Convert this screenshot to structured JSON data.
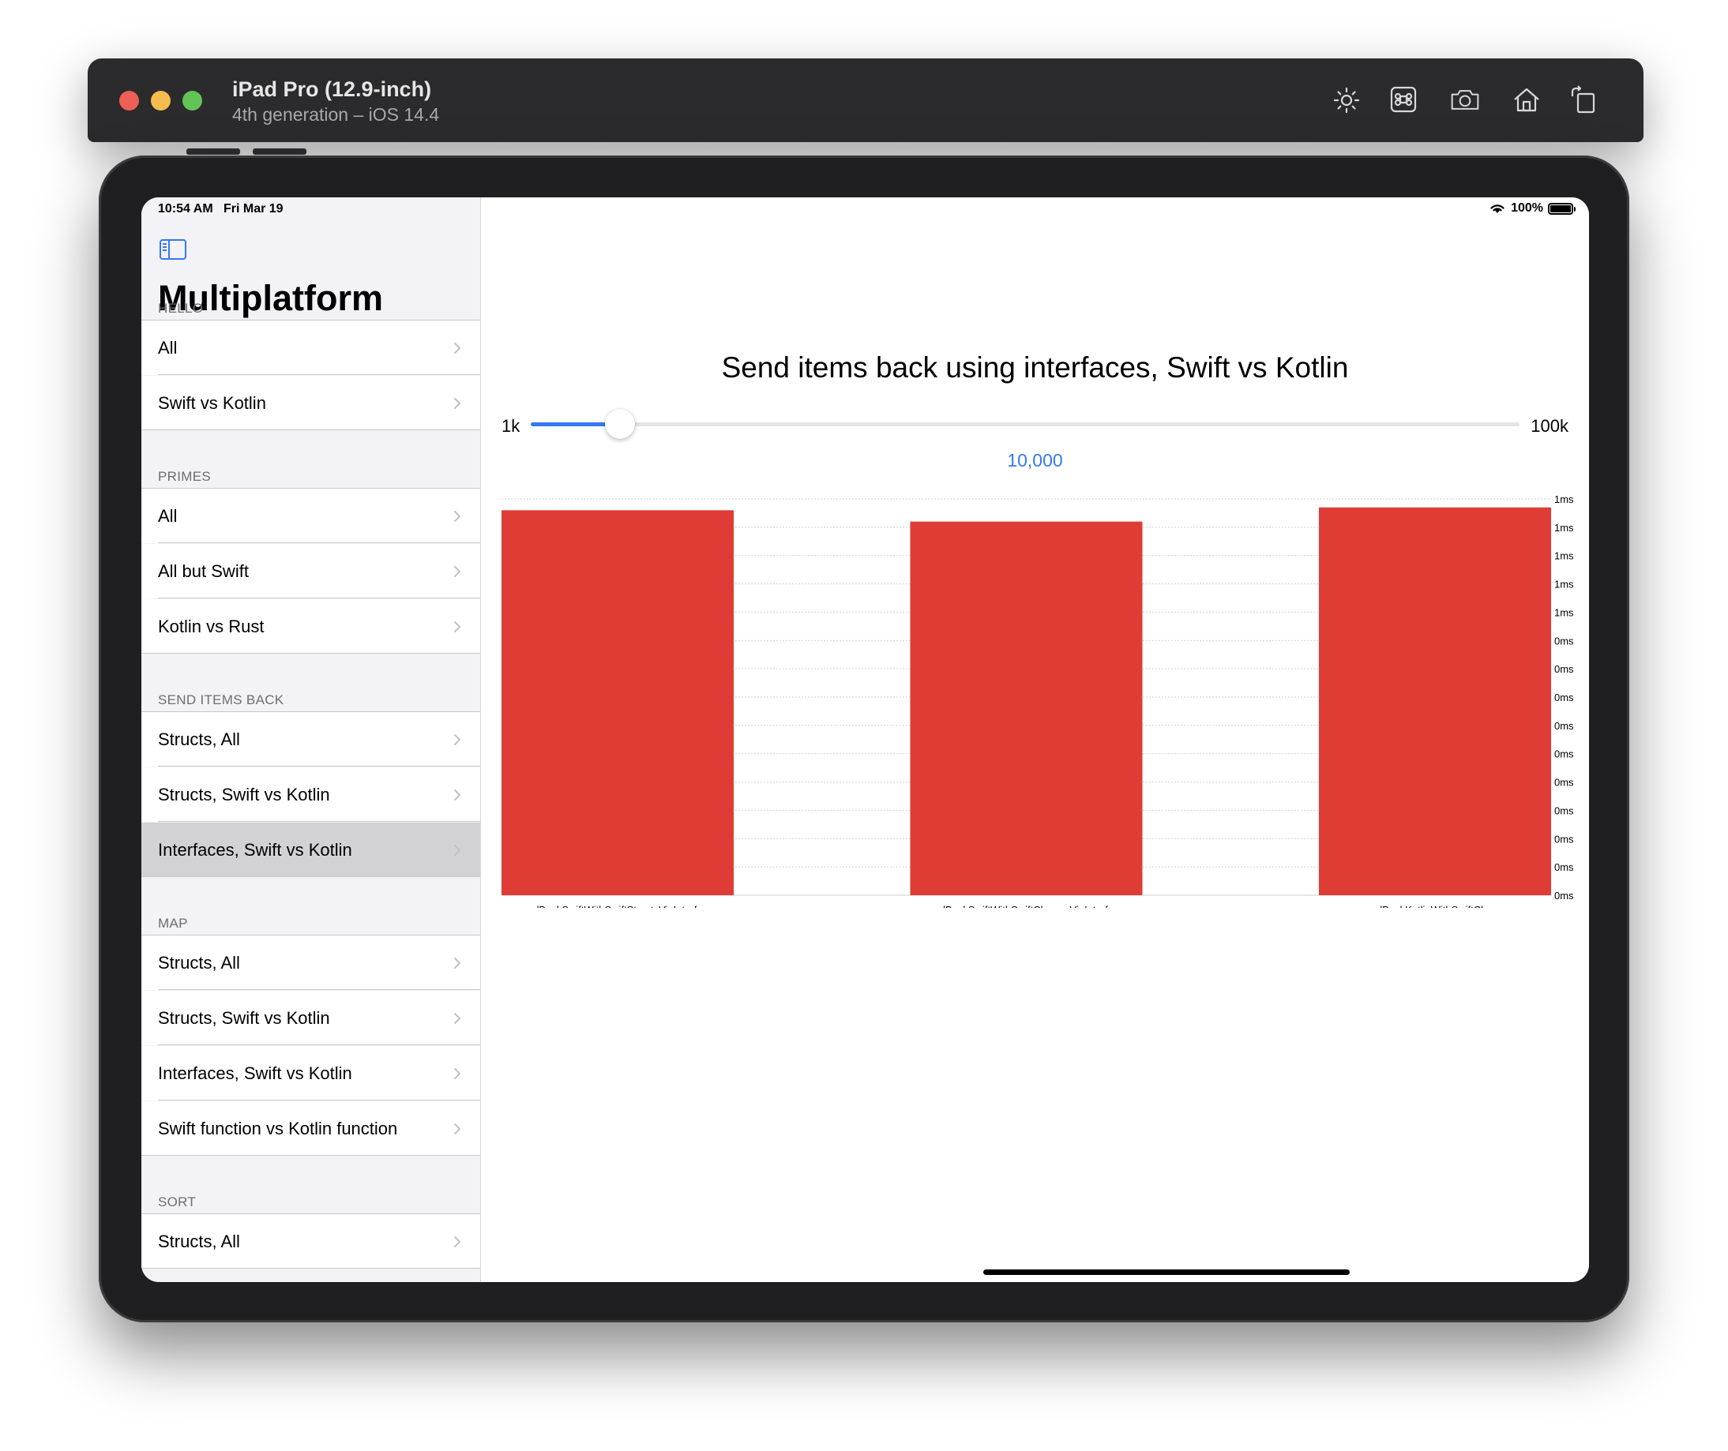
{
  "simulator": {
    "title": "iPad Pro (12.9-inch)",
    "subtitle": "4th generation – iOS 14.4",
    "tools": [
      "brightness-icon",
      "command-icon",
      "screenshot-icon",
      "home-icon",
      "rotate-icon"
    ]
  },
  "status_bar": {
    "time": "10:54 AM   Fri Mar 19",
    "battery": "100%"
  },
  "sidebar": {
    "title": "Multiplatform",
    "sections": [
      {
        "header": "HELLO",
        "items": [
          "All",
          "Swift vs Kotlin"
        ]
      },
      {
        "header": "PRIMES",
        "items": [
          "All",
          "All but Swift",
          "Kotlin vs Rust"
        ]
      },
      {
        "header": "SEND ITEMS BACK",
        "items": [
          "Structs, All",
          "Structs, Swift vs Kotlin",
          "Interfaces, Swift vs Kotlin"
        ]
      },
      {
        "header": "MAP",
        "items": [
          "Structs, All",
          "Structs, Swift vs Kotlin",
          "Interfaces, Swift vs Kotlin",
          "Swift function vs Kotlin function"
        ]
      },
      {
        "header": "SORT",
        "items": [
          "Structs, All"
        ]
      }
    ],
    "selected": "SEND ITEMS BACK / Interfaces, Swift vs Kotlin"
  },
  "detail": {
    "heading": "Send items back using interfaces, Swift vs Kotlin",
    "slider": {
      "min_label": "1k",
      "max_label": "100k",
      "value_label": "10,000",
      "fraction": 0.09
    }
  },
  "colors": {
    "bar": "#de3c35",
    "accent": "#3478f6"
  },
  "chart_data": {
    "type": "bar",
    "categories": [
      "sendBackSwiftWithSwiftStructsViaInterfaces",
      "sendBackSwiftWithSwiftClassesViaInterfaces",
      "sendBackKotlinWithSwiftClasses"
    ],
    "values": [
      0.68,
      0.66,
      0.685
    ],
    "ytick_labels": [
      "1ms",
      "1ms",
      "1ms",
      "1ms",
      "1ms",
      "0ms",
      "0ms",
      "0ms",
      "0ms",
      "0ms",
      "0ms",
      "0ms",
      "0ms",
      "0ms",
      "0ms"
    ],
    "ylim": [
      0,
      0.7
    ],
    "grid": true
  }
}
